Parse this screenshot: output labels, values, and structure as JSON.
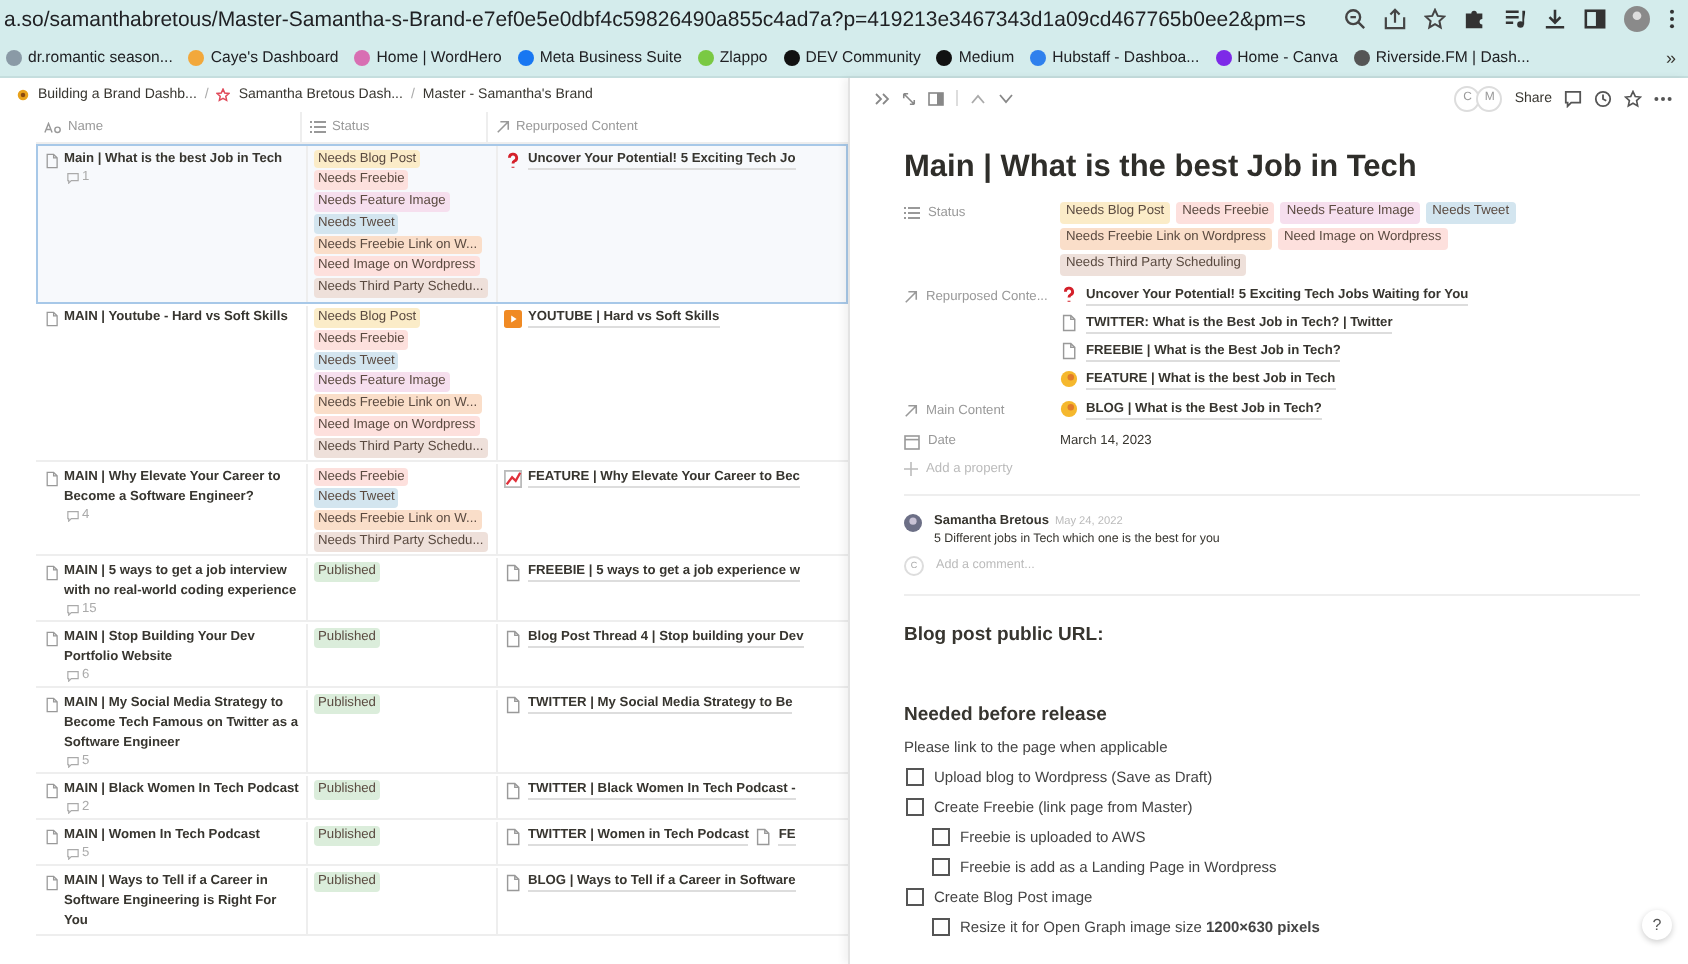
{
  "browser": {
    "url": "a.so/samanthabretous/Master-Samantha-s-Brand-e7ef0e5e0dbf4c59826490a855c4ad7a?p=419213e3467343d1a09cd467765b0ee2&pm=s",
    "bookmarks": [
      {
        "label": "dr.romantic season...",
        "color": "#8a9aa6"
      },
      {
        "label": "Caye's Dashboard",
        "color": "#f2a83b"
      },
      {
        "label": "Home | WordHero",
        "color": "#d86fb3"
      },
      {
        "label": "Meta Business Suite",
        "color": "#1877f2"
      },
      {
        "label": "Zlappo",
        "color": "#7ac943"
      },
      {
        "label": "DEV Community",
        "color": "#111111"
      },
      {
        "label": "Medium",
        "color": "#111111"
      },
      {
        "label": "Hubstaff - Dashboa...",
        "color": "#2f80ed"
      },
      {
        "label": "Home - Canva",
        "color": "#7d2ae8"
      },
      {
        "label": "Riverside.FM | Dash...",
        "color": "#555555"
      }
    ],
    "more": "»"
  },
  "breadcrumb_separator": "/",
  "breadcrumbs": [
    "Building a Brand Dashb...",
    "Samantha Bretous Dash...",
    "Master - Samantha's Brand"
  ],
  "table": {
    "columns": [
      "Name",
      "Status",
      "Repurposed Content"
    ],
    "rows": [
      {
        "name": "Main | What is the best Job in Tech",
        "comments": "1",
        "selected": true,
        "status": [
          {
            "label": "Needs Blog Post",
            "color": "#fbecc8"
          },
          {
            "label": "Needs Freebie",
            "color": "#fde0dd"
          },
          {
            "label": "Needs Feature Image",
            "color": "#f6dfee"
          },
          {
            "label": "Needs Tweet",
            "color": "#d3e5ef"
          },
          {
            "label": "Needs Freebie Link on W...",
            "color": "#fadec9"
          },
          {
            "label": "Need Image on Wordpress",
            "color": "#fde0dd"
          },
          {
            "label": "Needs Third Party Schedu...",
            "color": "#eee0da"
          }
        ],
        "repurposed": [
          {
            "kind": "question",
            "text": "Uncover Your Potential! 5 Exciting Tech Jo"
          }
        ]
      },
      {
        "name": "MAIN | Youtube - Hard vs Soft Skills",
        "selected": false,
        "status": [
          {
            "label": "Needs Blog Post",
            "color": "#fbecc8"
          },
          {
            "label": "Needs Freebie",
            "color": "#fde0dd"
          },
          {
            "label": "Needs Tweet",
            "color": "#d3e5ef"
          },
          {
            "label": "Needs Feature Image",
            "color": "#f6dfee"
          },
          {
            "label": "Needs Freebie Link on W...",
            "color": "#fadec9"
          },
          {
            "label": "Need Image on Wordpress",
            "color": "#fde0dd"
          },
          {
            "label": "Needs Third Party Schedu...",
            "color": "#eee0da"
          }
        ],
        "repurposed": [
          {
            "kind": "video",
            "text": "YOUTUBE | Hard vs Soft Skills"
          }
        ]
      },
      {
        "name": "MAIN | Why Elevate Your Career to Become a Software Engineer?",
        "comments": "4",
        "selected": false,
        "status": [
          {
            "label": "Needs Freebie",
            "color": "#fde0dd"
          },
          {
            "label": "Needs Tweet",
            "color": "#d3e5ef"
          },
          {
            "label": "Needs Freebie Link on W...",
            "color": "#fadec9"
          },
          {
            "label": "Needs Third Party Schedu...",
            "color": "#eee0da"
          }
        ],
        "repurposed": [
          {
            "kind": "chart",
            "text": "FEATURE | Why Elevate Your Career to Bec"
          }
        ]
      },
      {
        "name": "MAIN | 5 ways to get a job interview with no real-world coding experience",
        "comments": "15",
        "selected": false,
        "status": [
          {
            "label": "Published",
            "color": "#dbeddb"
          }
        ],
        "repurposed": [
          {
            "kind": "page",
            "text": "FREEBIE | 5 ways to get a job experience w"
          }
        ]
      },
      {
        "name": "MAIN | Stop Building Your Dev Portfolio Website",
        "comments": "6",
        "selected": false,
        "status": [
          {
            "label": "Published",
            "color": "#dbeddb"
          }
        ],
        "repurposed": [
          {
            "kind": "page",
            "text": "Blog Post Thread 4 | Stop building your Dev"
          }
        ]
      },
      {
        "name": "MAIN | My Social Media Strategy to Become Tech Famous on Twitter as a Software Engineer",
        "comments": "5",
        "selected": false,
        "status": [
          {
            "label": "Published",
            "color": "#dbeddb"
          }
        ],
        "repurposed": [
          {
            "kind": "page",
            "text": "TWITTER | My Social Media Strategy to Be"
          }
        ]
      },
      {
        "name": "MAIN | Black Women In Tech Podcast",
        "comments": "2",
        "selected": false,
        "status": [
          {
            "label": "Published",
            "color": "#dbeddb"
          }
        ],
        "repurposed": [
          {
            "kind": "page",
            "text": "TWITTER | Black Women In Tech Podcast -"
          }
        ]
      },
      {
        "name": "MAIN | Women In Tech Podcast",
        "comments": "5",
        "selected": false,
        "status": [
          {
            "label": "Published",
            "color": "#dbeddb"
          }
        ],
        "repurposed": [
          {
            "kind": "page",
            "text": "TWITTER | Women in Tech Podcast"
          },
          {
            "kind": "page",
            "text": "FE"
          }
        ]
      },
      {
        "name": "MAIN | Ways to Tell if a Career in Software Engineering is Right For You",
        "selected": false,
        "status": [
          {
            "label": "Published",
            "color": "#dbeddb"
          }
        ],
        "repurposed": [
          {
            "kind": "page",
            "text": "BLOG | Ways to Tell if a Career in Software"
          }
        ]
      }
    ]
  },
  "page": {
    "avatars": [
      "C",
      "M"
    ],
    "share": "Share",
    "title": "Main | What is the best Job in Tech",
    "properties": [
      {
        "kind": "tags",
        "label": "Status",
        "tags": [
          {
            "label": "Needs Blog Post",
            "color": "#fbecc8"
          },
          {
            "label": "Needs Freebie",
            "color": "#fde0dd"
          },
          {
            "label": "Needs Feature Image",
            "color": "#f6dfee"
          },
          {
            "label": "Needs Tweet",
            "color": "#d3e5ef"
          },
          {
            "label": "Needs Freebie Link on Wordpress",
            "color": "#fadec9"
          },
          {
            "label": "Need Image on Wordpress",
            "color": "#fde0dd"
          },
          {
            "label": "Needs Third Party Scheduling",
            "color": "#eee0da"
          }
        ]
      },
      {
        "kind": "relation",
        "label": "Repurposed Conte...",
        "links": [
          {
            "kind": "question",
            "text": "Uncover Your Potential! 5 Exciting Tech Jobs Waiting for You"
          },
          {
            "kind": "page",
            "text": "TWITTER: What is the Best Job in Tech? | Twitter"
          },
          {
            "kind": "page",
            "text": "FREEBIE | What is the Best Job in Tech?"
          },
          {
            "kind": "emoji",
            "text": "FEATURE | What is the best Job in Tech"
          }
        ]
      },
      {
        "kind": "relation",
        "label": "Main Content",
        "links": [
          {
            "kind": "emoji",
            "text": "BLOG | What is the Best Job in Tech?"
          }
        ]
      },
      {
        "kind": "date",
        "label": "Date",
        "value": "March 14, 2023"
      }
    ],
    "add_property": "Add a property",
    "comment": {
      "author": "Samantha Bretous",
      "date": "May 24, 2022",
      "text": "5 Different jobs in Tech which one is the best for you"
    },
    "comment_avatar": "C",
    "comment_placeholder": "Add a comment...",
    "url_heading": "Blog post public URL:",
    "release_heading": "Needed before release",
    "release_note": "Please link to the page when applicable",
    "checklist": [
      {
        "text": "Upload blog to Wordpress (Save as Draft)",
        "checked": false
      },
      {
        "text": "Create Freebie (link page from Master)",
        "checked": false,
        "children": [
          {
            "text": "Freebie is uploaded to AWS",
            "checked": false
          },
          {
            "text": "Freebie is add as a Landing Page in Wordpress",
            "checked": false
          }
        ]
      },
      {
        "text": "Create Blog Post image",
        "checked": false,
        "children": [
          {
            "text": "Resize it for Open Graph image size **1200×630 pixels**",
            "checked": false
          }
        ]
      }
    ],
    "help": "?"
  }
}
